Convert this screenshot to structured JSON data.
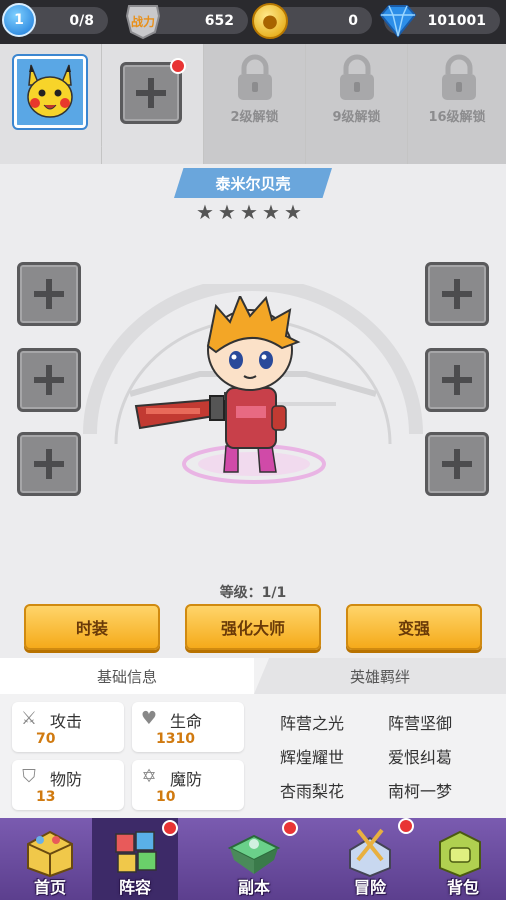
{
  "topbar": {
    "level": "1",
    "stamina": "0/8",
    "power_label": "战力",
    "power": "652",
    "gold": "0",
    "diamonds": "101001"
  },
  "slots": {
    "locks": [
      {
        "label": "2级解锁"
      },
      {
        "label": "9级解锁"
      },
      {
        "label": "16级解锁"
      }
    ]
  },
  "hero": {
    "name": "泰米尔贝壳",
    "stars": 5,
    "level_text": "等级：1/1"
  },
  "buttons": {
    "fashion": "时装",
    "master": "强化大师",
    "strengthen": "变强"
  },
  "info": {
    "tab_base": "基础信息",
    "tab_bond": "英雄羁绊",
    "stats": [
      {
        "name": "攻击",
        "value": "70",
        "icon": "sword-icon"
      },
      {
        "name": "生命",
        "value": "1310",
        "icon": "heart-icon"
      },
      {
        "name": "物防",
        "value": "13",
        "icon": "shield-icon"
      },
      {
        "name": "魔防",
        "value": "10",
        "icon": "hexagram-icon"
      }
    ],
    "bonds": [
      "阵营之光",
      "阵营坚御",
      "辉煌耀世",
      "爱恨纠葛",
      "杏雨梨花",
      "南柯一梦"
    ]
  },
  "nav": {
    "items": [
      {
        "label": "首页"
      },
      {
        "label": "阵容"
      },
      {
        "label": "副本"
      },
      {
        "label": "冒险"
      },
      {
        "label": "背包"
      }
    ]
  },
  "colors": {
    "accent_button": "#f5aa1a",
    "badge_red": "#e83434",
    "nav_purple": "#6a4ca0",
    "name_banner": "#6aa6dc"
  }
}
